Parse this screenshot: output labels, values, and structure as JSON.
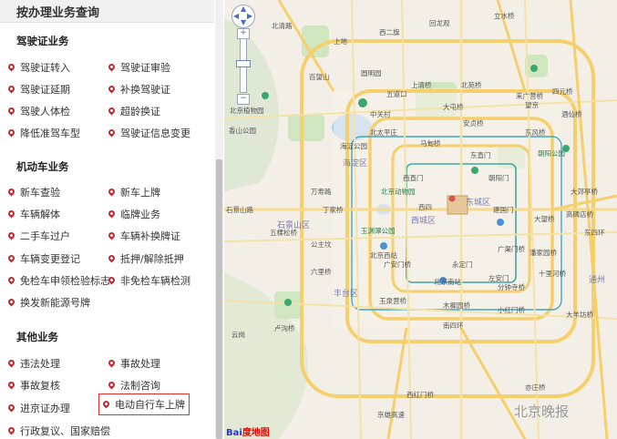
{
  "sidebar": {
    "header": "按办理业务查询",
    "sections": [
      {
        "title": "驾驶证业务",
        "items": [
          "驾驶证转入",
          "驾驶证审验",
          "驾驶证延期",
          "补换驾驶证",
          "驾驶人体检",
          "超龄换证",
          "降低准驾车型",
          "驾驶证信息变更"
        ]
      },
      {
        "title": "机动车业务",
        "items": [
          "新车查验",
          "新车上牌",
          "车辆解体",
          "临牌业务",
          "二手车过户",
          "车辆补换牌证",
          "车辆变更登记",
          "抵押/解除抵押",
          "免检车申领检验标志",
          "非免检车辆检测",
          "换发新能源号牌"
        ]
      },
      {
        "title": "其他业务",
        "items": [
          "违法处理",
          "事故处理",
          "事故复核",
          "法制咨询",
          "进京证办理",
          "电动自行车上牌",
          "行政复议、国家赔偿"
        ]
      }
    ],
    "highlighted_item": "电动自行车上牌"
  },
  "map": {
    "labels": {
      "qinghe": "北清路",
      "baiwangshan": "百望山",
      "xiangshan": "香山公园",
      "botanical": "北京植物园",
      "haidian_park": "海淀公园",
      "haidian": "海淀区",
      "shijingshan": "石景山区",
      "xicheng": "西城区",
      "dongcheng": "东城区",
      "fengtai": "丰台区",
      "chaoyang_park": "朝阳公园",
      "lishuiqiao": "立水桥",
      "anzhen": "安贞桥",
      "dawang": "大望桥",
      "dongfeng": "东风桥",
      "laiguangying": "来广营桥",
      "guangqumen": "广渠门桥",
      "xizhimen": "西直门",
      "xisi": "西四",
      "guangan": "广安门桥",
      "zhongguancun": "中关村",
      "wudaokou": "五道口",
      "shijingshan_rd": "石景山路",
      "dingjia": "丁家桥",
      "gongzhufen": "公主坟",
      "beijing_west": "北京西站",
      "beijing_south": "北京南站",
      "liuliqiao": "六里桥",
      "yuquanying": "玉泉营桥",
      "muxiyuan": "木樨园桥",
      "sihuan": "南四环",
      "xihongmen": "西红门桥",
      "yizhuang": "亦庄桥",
      "wukesong": "五棵松桥",
      "dongsihuan": "东四环",
      "yuanmingyuan": "圆明园",
      "shangqing": "上清桥",
      "beiyuan": "北苑桥",
      "datun": "大屯桥",
      "madian": "马甸桥",
      "beitaipingzhuang": "北太平庄",
      "dongzhimen": "东直门",
      "chaoyangmen": "朝阳门",
      "jianguomen": "建国门",
      "yongdingmen": "永定门",
      "zuoanmen": "左安门",
      "fenzhongsi": "分钟寺桥",
      "xiaohongmen": "小红门桥",
      "yuyuantan": "玉渊潭公园",
      "beijing_zoo": "北京动物园",
      "wanshou": "万寿路",
      "jingxiong": "京雄高速",
      "panjiayuan": "潘家园桥",
      "shilihe": "十里河桥",
      "gaobeidian": "高碑店桥",
      "tongzhou": "通州",
      "shangdi": "上地",
      "xierqi": "西二旗",
      "huilongguan": "回龙观",
      "wangjing": "望京",
      "jiuxianqiao": "酒仙桥",
      "siyuan": "四元桥",
      "dayang": "大羊坊桥",
      "lugouqiao": "卢沟桥",
      "yungang": "云岗",
      "dajiaoting": "大郊亭桥"
    },
    "watermark": "北京晚报",
    "logo_text": "Bai",
    "logo_red": "度地图",
    "zoom_plus": "+",
    "zoom_minus": "−"
  }
}
